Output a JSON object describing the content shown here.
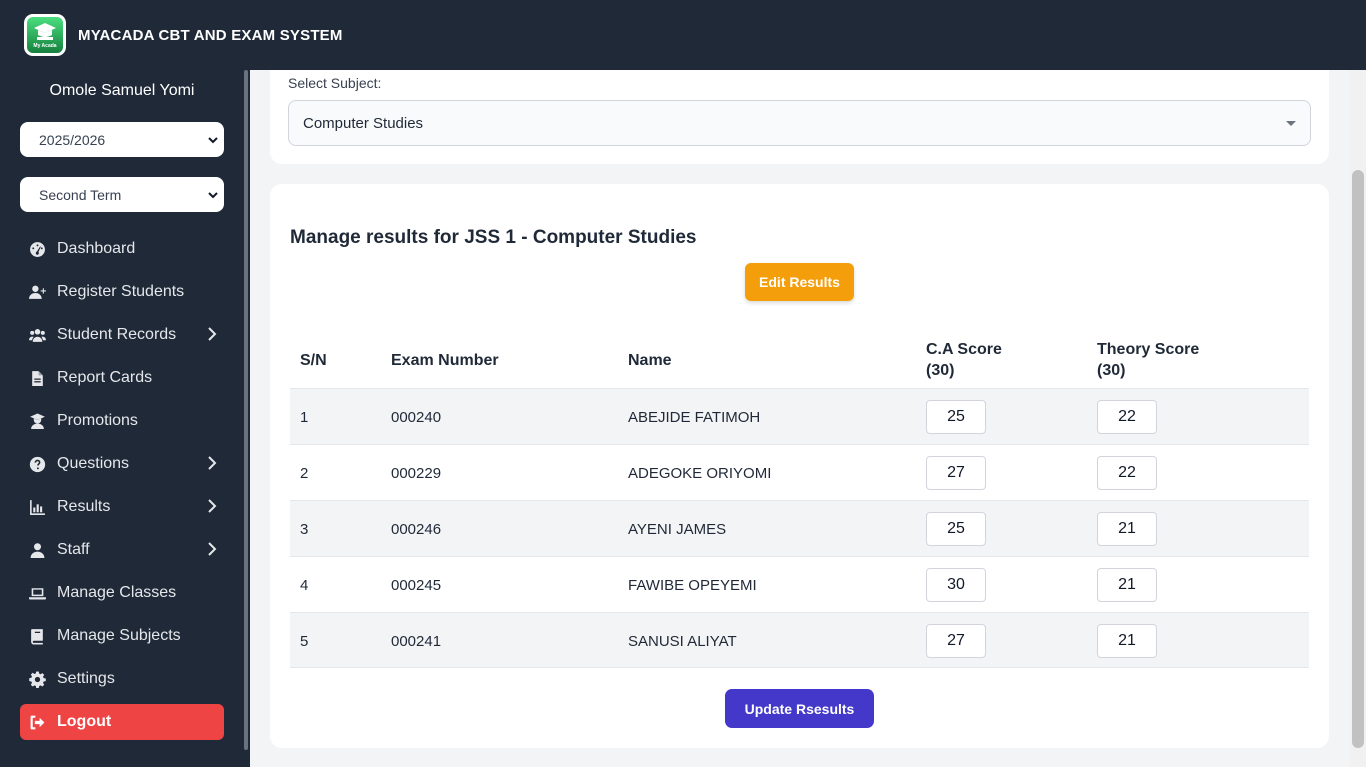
{
  "app": {
    "title": "MYACADA CBT AND EXAM SYSTEM",
    "logo_text": "My Acada"
  },
  "sidebar": {
    "user_name": "Omole Samuel Yomi",
    "session": "2025/2026",
    "term": "Second Term",
    "items": [
      {
        "label": "Dashboard",
        "icon": "gauge-icon",
        "has_submenu": false
      },
      {
        "label": "Register Students",
        "icon": "user-plus-icon",
        "has_submenu": false
      },
      {
        "label": "Student Records",
        "icon": "users-icon",
        "has_submenu": true
      },
      {
        "label": "Report Cards",
        "icon": "file-icon",
        "has_submenu": false
      },
      {
        "label": "Promotions",
        "icon": "graduate-icon",
        "has_submenu": false
      },
      {
        "label": "Questions",
        "icon": "question-icon",
        "has_submenu": true
      },
      {
        "label": "Results",
        "icon": "chart-icon",
        "has_submenu": true
      },
      {
        "label": "Staff",
        "icon": "user-icon",
        "has_submenu": true
      },
      {
        "label": "Manage Classes",
        "icon": "laptop-icon",
        "has_submenu": false
      },
      {
        "label": "Manage Subjects",
        "icon": "book-icon",
        "has_submenu": false
      },
      {
        "label": "Settings",
        "icon": "gear-icon",
        "has_submenu": false
      }
    ],
    "logout": "Logout"
  },
  "subject": {
    "label": "Select Subject:",
    "value": "Computer Studies"
  },
  "results": {
    "heading": "Manage results for JSS 1 - Computer Studies",
    "edit_label": "Edit Results",
    "update_label": "Update Rsesults",
    "columns": {
      "sn": "S/N",
      "exam": "Exam Number",
      "name": "Name",
      "ca_1": "C.A Score",
      "ca_2": "(30)",
      "theory_1": "Theory Score",
      "theory_2": "(30)"
    },
    "rows": [
      {
        "sn": "1",
        "exam": "000240",
        "name": "ABEJIDE FATIMOH",
        "ca": "25",
        "theory": "22"
      },
      {
        "sn": "2",
        "exam": "000229",
        "name": "ADEGOKE ORIYOMI",
        "ca": "27",
        "theory": "22"
      },
      {
        "sn": "3",
        "exam": "000246",
        "name": "AYENI JAMES",
        "ca": "25",
        "theory": "21"
      },
      {
        "sn": "4",
        "exam": "000245",
        "name": "FAWIBE OPEYEMI",
        "ca": "30",
        "theory": "21"
      },
      {
        "sn": "5",
        "exam": "000241",
        "name": "SANUSI ALIYAT",
        "ca": "27",
        "theory": "21"
      }
    ]
  },
  "colors": {
    "sidebar_bg": "#1f2937",
    "edit_button": "#f59e0b",
    "update_button": "#4338ca",
    "logout": "#ef4444"
  }
}
